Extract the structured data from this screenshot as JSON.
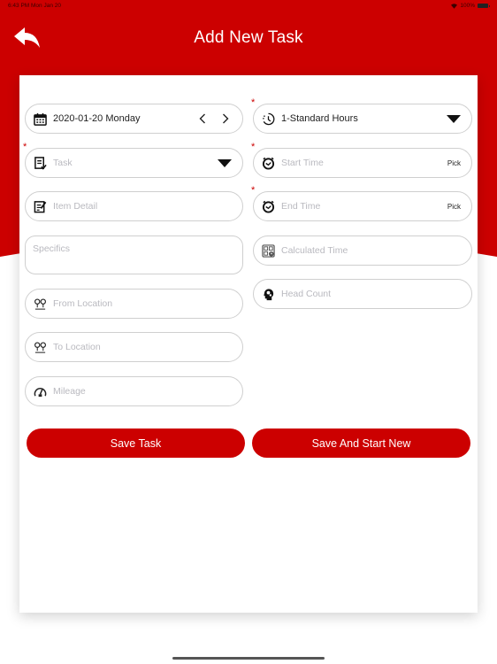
{
  "status_bar": {
    "time": "6:43 PM   Mon Jan 20",
    "battery": "100%"
  },
  "header": {
    "title": "Add New Task",
    "back_icon": "reply-arrow-icon"
  },
  "colors": {
    "brand_red": "#cc0000",
    "placeholder": "#b9b9bf",
    "border": "#cfcfcf"
  },
  "form": {
    "date": {
      "value": "2020-01-20 Monday",
      "icon": "calendar-icon"
    },
    "task": {
      "placeholder": "Task",
      "required": true,
      "icon": "task-checklist-icon"
    },
    "item_detail": {
      "placeholder": "Item Detail",
      "icon": "edit-document-icon"
    },
    "specifics": {
      "placeholder": "Specifics"
    },
    "from_location": {
      "placeholder": "From Location",
      "icon": "location-pins-icon"
    },
    "to_location": {
      "placeholder": "To Location",
      "icon": "location-pins-icon"
    },
    "mileage": {
      "placeholder": "Mileage",
      "icon": "speedometer-icon"
    },
    "hours_type": {
      "value": "1-Standard Hours",
      "required": true,
      "icon": "clock-history-icon"
    },
    "start_time": {
      "placeholder": "Start Time",
      "required": true,
      "pick_label": "Pick",
      "icon": "alarm-clock-icon"
    },
    "end_time": {
      "placeholder": "End Time",
      "required": true,
      "pick_label": "Pick",
      "icon": "alarm-clock-icon"
    },
    "calculated_time": {
      "placeholder": "Calculated Time",
      "icon": "calculator-clock-icon"
    },
    "head_count": {
      "placeholder": "Head Count",
      "icon": "head-gears-icon"
    },
    "required_marker": "*"
  },
  "buttons": {
    "save_task": "Save Task",
    "save_and_start_new": "Save And Start New"
  }
}
